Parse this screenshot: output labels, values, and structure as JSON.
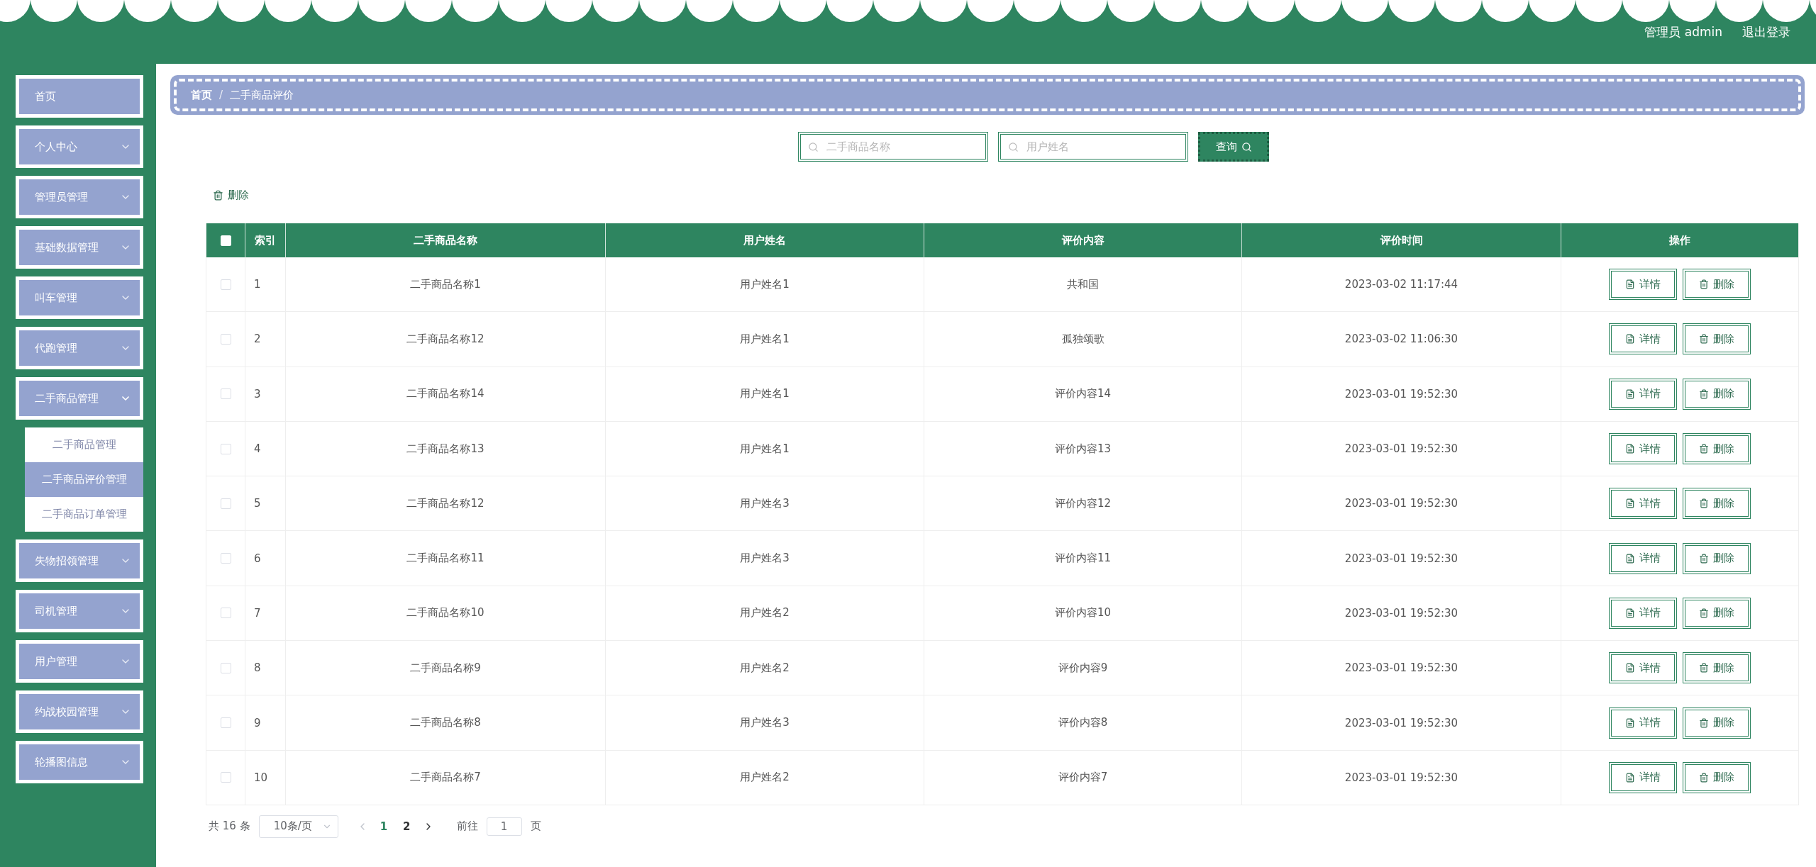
{
  "header": {
    "user": "管理员 admin",
    "logout": "退出登录"
  },
  "sidebar": {
    "items": [
      {
        "label": "首页"
      },
      {
        "label": "个人中心",
        "expanded": false
      },
      {
        "label": "管理员管理",
        "expanded": false
      },
      {
        "label": "基础数据管理",
        "expanded": false
      },
      {
        "label": "叫车管理",
        "expanded": false
      },
      {
        "label": "代跑管理",
        "expanded": false
      },
      {
        "label": "二手商品管理",
        "expanded": true,
        "children": [
          {
            "label": "二手商品管理",
            "selected": false
          },
          {
            "label": "二手商品评价管理",
            "selected": true
          },
          {
            "label": "二手商品订单管理",
            "selected": false
          }
        ]
      },
      {
        "label": "失物招领管理",
        "expanded": false
      },
      {
        "label": "司机管理",
        "expanded": false
      },
      {
        "label": "用户管理",
        "expanded": false
      },
      {
        "label": "约战校园管理",
        "expanded": false
      },
      {
        "label": "轮播图信息",
        "expanded": false
      }
    ]
  },
  "breadcrumb": {
    "items": [
      "首页",
      "二手商品评价"
    ],
    "separator": "/"
  },
  "search": {
    "fields": [
      {
        "placeholder": "二手商品名称"
      },
      {
        "placeholder": "用户姓名"
      }
    ],
    "button": "查询"
  },
  "bulk_delete": "删除",
  "table": {
    "columns": [
      "索引",
      "二手商品名称",
      "用户姓名",
      "评价内容",
      "评价时间",
      "操作"
    ],
    "all_checked": false,
    "rows": [
      {
        "checked": false,
        "cells": [
          "1",
          "二手商品名称1",
          "用户姓名1",
          "共和国",
          "2023-03-02 11:17:44"
        ],
        "actions": [
          "详情",
          "删除"
        ]
      },
      {
        "checked": false,
        "cells": [
          "2",
          "二手商品名称12",
          "用户姓名1",
          "孤独颂歌",
          "2023-03-02 11:06:30"
        ],
        "actions": [
          "详情",
          "删除"
        ]
      },
      {
        "checked": false,
        "cells": [
          "3",
          "二手商品名称14",
          "用户姓名1",
          "评价内容14",
          "2023-03-01 19:52:30"
        ],
        "actions": [
          "详情",
          "删除"
        ]
      },
      {
        "checked": false,
        "cells": [
          "4",
          "二手商品名称13",
          "用户姓名1",
          "评价内容13",
          "2023-03-01 19:52:30"
        ],
        "actions": [
          "详情",
          "删除"
        ]
      },
      {
        "checked": false,
        "cells": [
          "5",
          "二手商品名称12",
          "用户姓名3",
          "评价内容12",
          "2023-03-01 19:52:30"
        ],
        "actions": [
          "详情",
          "删除"
        ]
      },
      {
        "checked": false,
        "cells": [
          "6",
          "二手商品名称11",
          "用户姓名3",
          "评价内容11",
          "2023-03-01 19:52:30"
        ],
        "actions": [
          "详情",
          "删除"
        ]
      },
      {
        "checked": false,
        "cells": [
          "7",
          "二手商品名称10",
          "用户姓名2",
          "评价内容10",
          "2023-03-01 19:52:30"
        ],
        "actions": [
          "详情",
          "删除"
        ]
      },
      {
        "checked": false,
        "cells": [
          "8",
          "二手商品名称9",
          "用户姓名2",
          "评价内容9",
          "2023-03-01 19:52:30"
        ],
        "actions": [
          "详情",
          "删除"
        ]
      },
      {
        "checked": false,
        "cells": [
          "9",
          "二手商品名称8",
          "用户姓名3",
          "评价内容8",
          "2023-03-01 19:52:30"
        ],
        "actions": [
          "详情",
          "删除"
        ]
      },
      {
        "checked": false,
        "cells": [
          "10",
          "二手商品名称7",
          "用户姓名2",
          "评价内容7",
          "2023-03-01 19:52:30"
        ],
        "actions": [
          "详情",
          "删除"
        ]
      }
    ]
  },
  "pagination": {
    "total": "共 16 条",
    "page_size": "10条/页",
    "pages": [
      {
        "label": "1",
        "selected": true
      },
      {
        "label": "2",
        "selected": false
      }
    ],
    "goto_label": "前往",
    "goto_value": "1",
    "goto_suffix": "页"
  }
}
